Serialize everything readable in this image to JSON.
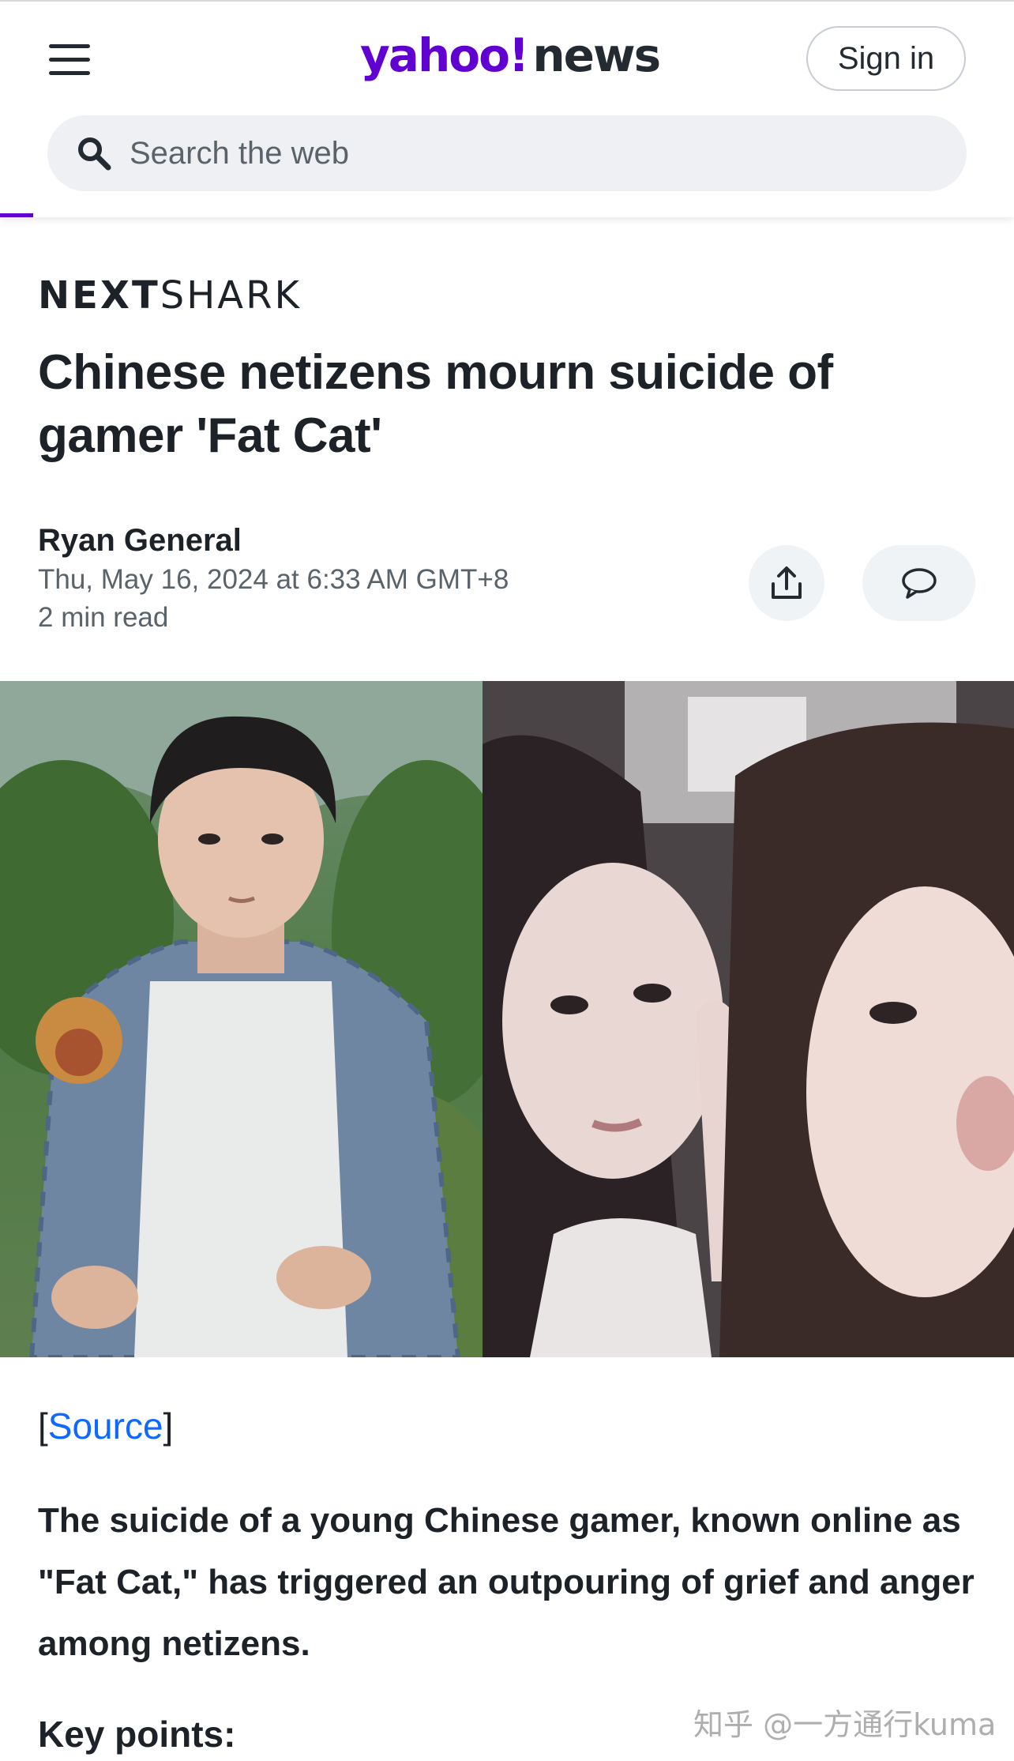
{
  "header": {
    "logo_yahoo": "yahoo!",
    "logo_news": "news",
    "signin_label": "Sign in",
    "search_placeholder": "Search the web",
    "brand_color": "#6001d2"
  },
  "article": {
    "publisher_bold": "NEXT",
    "publisher_light": "SHARK",
    "headline": "Chinese netizens mourn suicide of gamer 'Fat Cat'",
    "author": "Ryan General",
    "date": "Thu, May 16, 2024 at 6:33 AM GMT+8",
    "read_time": "2 min read",
    "source_open": "[",
    "source_link": "Source",
    "source_close": "]",
    "lead": "The suicide of a young Chinese gamer, known online as \"Fat Cat,\" has triggered an outpouring of grief and anger among netizens.",
    "key_points": "Key points:"
  },
  "icons": {
    "menu": "hamburger-icon",
    "search": "search-icon",
    "share": "share-icon",
    "comment": "comment-icon"
  },
  "watermark": "知乎 @一方通行kuma"
}
